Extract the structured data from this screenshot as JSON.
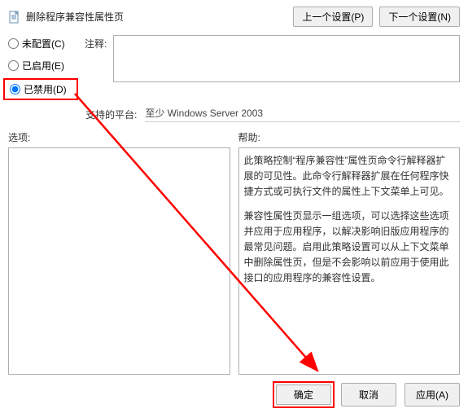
{
  "header": {
    "title": "删除程序兼容性属性页",
    "prev": "上一个设置(P)",
    "next": "下一个设置(N)"
  },
  "radios": {
    "not_configured": "未配置(C)",
    "enabled": "已启用(E)",
    "disabled": "已禁用(D)"
  },
  "comment": {
    "label": "注释:",
    "value": ""
  },
  "platform": {
    "label": "支持的平台:",
    "value": "至少 Windows Server 2003"
  },
  "panes": {
    "options_label": "选项:",
    "help_label": "帮助:",
    "help_p1": "此策略控制“程序兼容性”属性页命令行解释器扩展的可见性。此命令行解释器扩展在任何程序快捷方式或可执行文件的属性上下文菜单上可见。",
    "help_p2": "兼容性属性页显示一组选项，可以选择这些选项并应用于应用程序，以解决影响旧版应用程序的最常见问题。启用此策略设置可以从上下文菜单中删除属性页，但是不会影响以前应用于使用此接口的应用程序的兼容性设置。"
  },
  "buttons": {
    "ok": "确定",
    "cancel": "取消",
    "apply": "应用(A)"
  }
}
